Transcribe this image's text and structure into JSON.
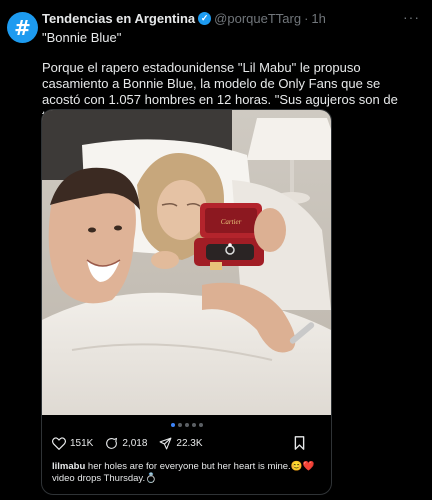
{
  "author": {
    "avatar_glyph": "#",
    "name": "Tendencias en Argentina",
    "handle": "@porqueTTarg",
    "separator": "·",
    "time": "1h",
    "verified_icon": "verified-badge-icon"
  },
  "more_label": "···",
  "subtitle": "\"Bonnie Blue\"",
  "body": "Porque el rapero estadounidense \"Lil Mabu\" le propuso casamiento a Bonnie Blue, la modelo de Only Fans que se acostó con 1.057 hombres en 12 horas.  \"Sus agujeros son de todos, pero su corazón es mío\".",
  "ring_box_brand": "Cartier",
  "embed": {
    "carousel": {
      "count": 5,
      "active": 0
    },
    "likes": "151K",
    "comments": "2,018",
    "shares": "22.3K",
    "caption_user": "lilmabu",
    "caption_text": "her holes are for everyone but her heart is mine.😊❤️ video drops Thursday.💍"
  },
  "colors": {
    "accent": "#1d9bf0",
    "background": "#000000",
    "muted": "#71767b"
  }
}
